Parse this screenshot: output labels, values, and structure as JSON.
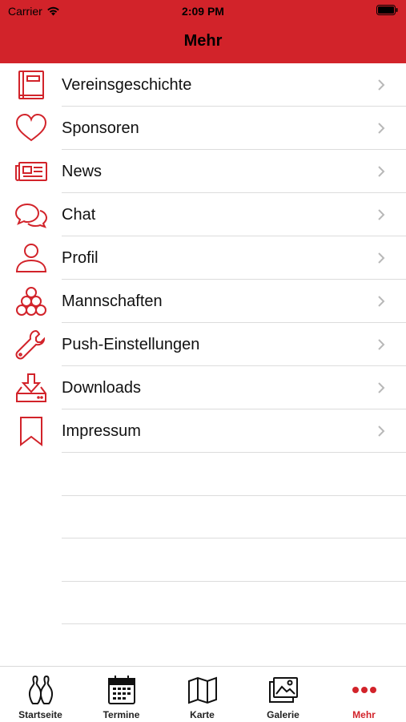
{
  "status": {
    "carrier": "Carrier",
    "time": "2:09 PM"
  },
  "nav": {
    "title": "Mehr"
  },
  "colors": {
    "accent": "#d2232a",
    "separator": "#dcdcdc",
    "chevron": "#b8b8b8"
  },
  "menu": [
    {
      "label": "Vereinsgeschichte",
      "icon": "book-icon"
    },
    {
      "label": "Sponsoren",
      "icon": "heart-icon"
    },
    {
      "label": "News",
      "icon": "newspaper-icon"
    },
    {
      "label": "Chat",
      "icon": "chat-bubbles-icon"
    },
    {
      "label": "Profil",
      "icon": "person-icon"
    },
    {
      "label": "Mannschaften",
      "icon": "team-balls-icon"
    },
    {
      "label": "Push-Einstellungen",
      "icon": "wrench-icon"
    },
    {
      "label": "Downloads",
      "icon": "download-tray-icon"
    },
    {
      "label": "Impressum",
      "icon": "bookmark-icon"
    }
  ],
  "tabs": [
    {
      "label": "Startseite",
      "icon": "bowling-pins-icon"
    },
    {
      "label": "Termine",
      "icon": "calendar-icon"
    },
    {
      "label": "Karte",
      "icon": "map-icon"
    },
    {
      "label": "Galerie",
      "icon": "gallery-icon"
    },
    {
      "label": "Mehr",
      "icon": "more-dots-icon",
      "active": true
    }
  ]
}
